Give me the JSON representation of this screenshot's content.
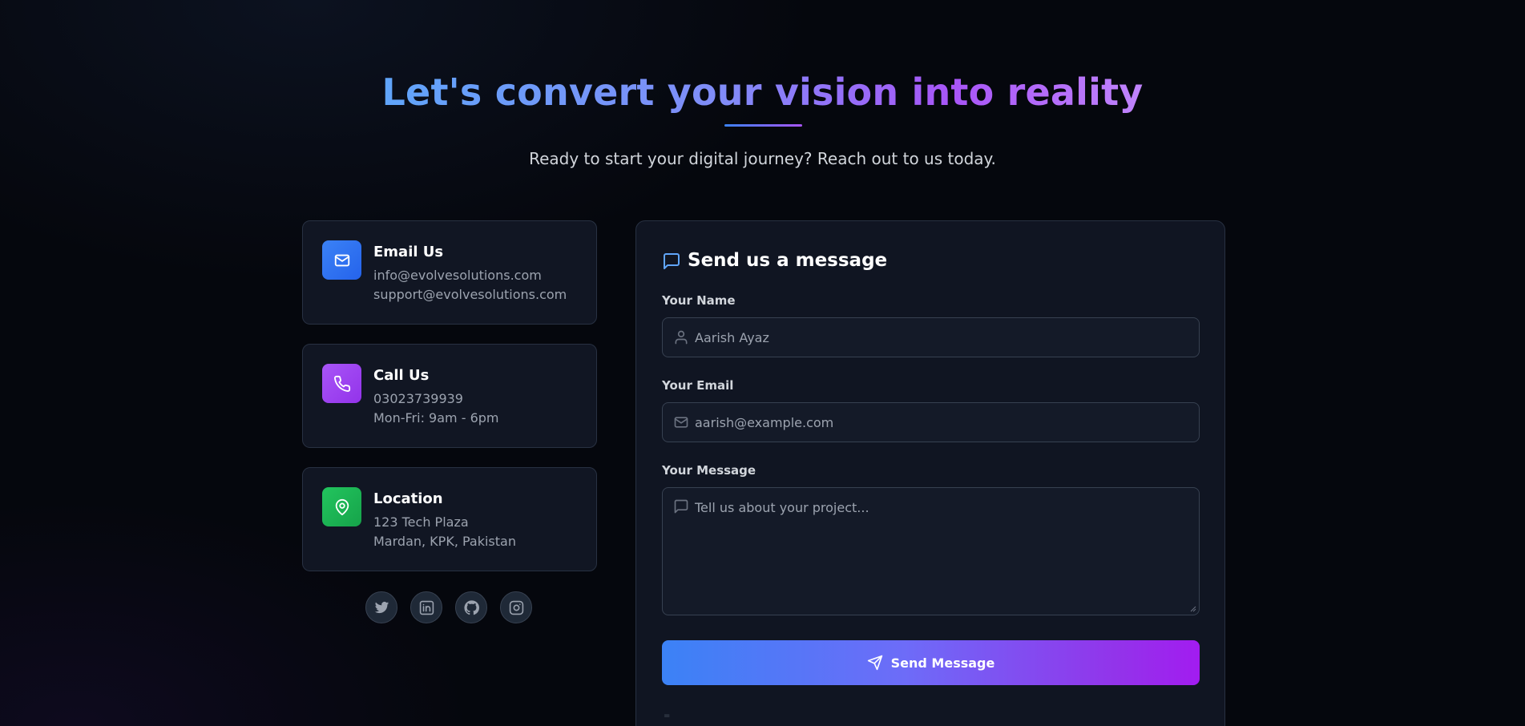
{
  "hero": {
    "title": "Let's convert your vision into reality",
    "subtitle": "Ready to start your digital journey? Reach out to us today."
  },
  "contact_cards": [
    {
      "icon": "mail-icon",
      "title": "Email Us",
      "lines": [
        "info@evolvesolutions.com",
        "support@evolvesolutions.com"
      ],
      "accent": "#3b82f6"
    },
    {
      "icon": "phone-icon",
      "title": "Call Us",
      "lines": [
        "03023739939",
        "Mon-Fri: 9am - 6pm"
      ],
      "accent": "#a855f7"
    },
    {
      "icon": "map-pin-icon",
      "title": "Location",
      "lines": [
        "123 Tech Plaza",
        "Mardan, KPK, Pakistan"
      ],
      "accent": "#22c55e"
    }
  ],
  "social": [
    "twitter-icon",
    "linkedin-icon",
    "github-icon",
    "instagram-icon"
  ],
  "form": {
    "title": "Send us a message",
    "name_label": "Your Name",
    "name_placeholder": "Aarish Ayaz",
    "email_label": "Your Email",
    "email_placeholder": "aarish@example.com",
    "message_label": "Your Message",
    "message_placeholder": "Tell us about your project...",
    "submit_label": "Send Message",
    "footer_mark": "="
  },
  "colors": {
    "background": "#05070d",
    "card": "#111623",
    "gradient_start": "#3b82f6",
    "gradient_end": "#a855f7"
  }
}
